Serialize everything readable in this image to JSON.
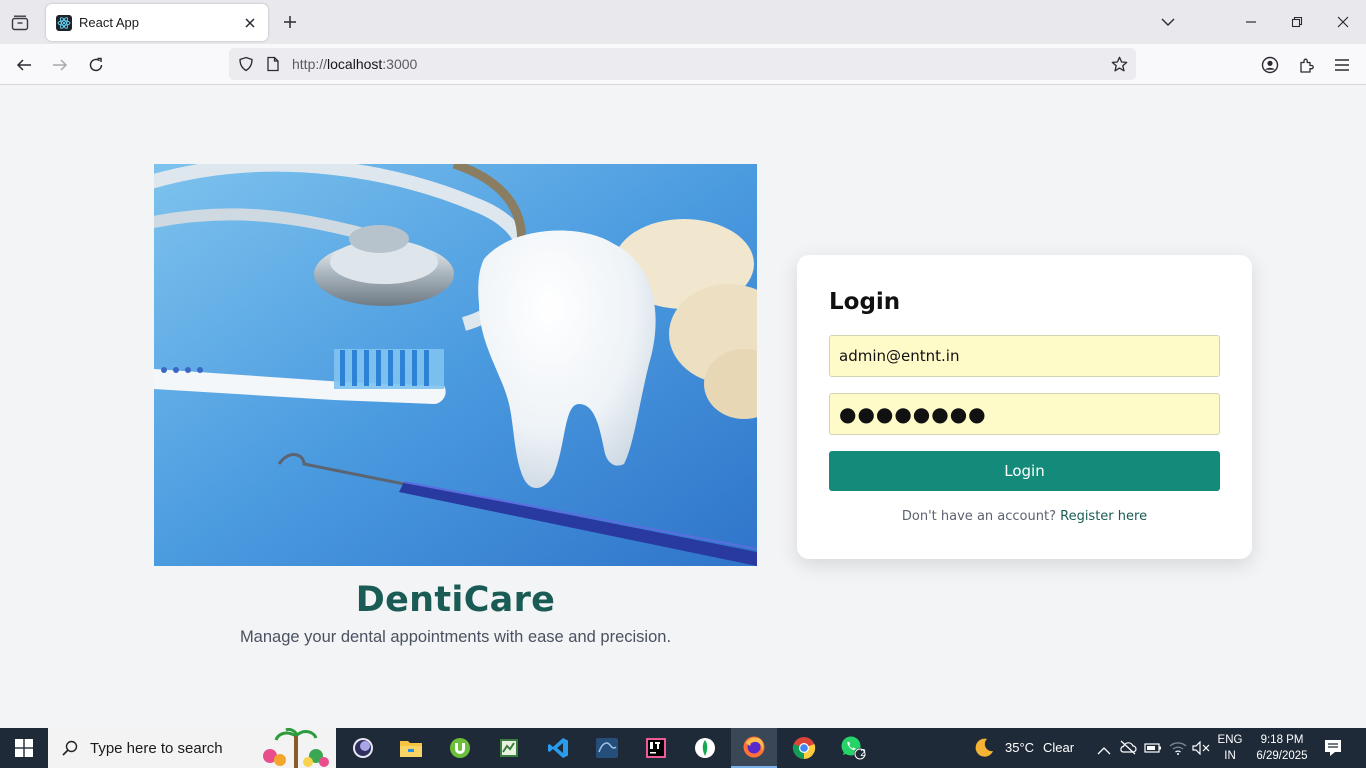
{
  "browser": {
    "tab_title": "React App",
    "url_prefix": "http://",
    "url_host": "localhost",
    "url_suffix": ":3000"
  },
  "page": {
    "brand_name": "DentiCare",
    "tagline": "Manage your dental appointments with ease and precision."
  },
  "login": {
    "heading": "Login",
    "email_value": "admin@entnt.in",
    "password_value": "●●●●●●●●",
    "submit_label": "Login",
    "register_prompt": "Don't have an account?",
    "register_link": "Register here"
  },
  "taskbar": {
    "search_placeholder": "Type here to search",
    "weather_temp": "35°C",
    "weather_cond": "Clear",
    "lang_1": "ENG",
    "lang_2": "IN",
    "time": "9:18 PM",
    "date": "6/29/2025",
    "whatsapp_badge": "2",
    "apps": [
      "obs-icon",
      "file-explorer-icon",
      "utorrent-icon",
      "sublime-icon",
      "vscode-icon",
      "mysql-workbench-icon",
      "intellij-icon",
      "mongodb-compass-icon",
      "firefox-icon",
      "chrome-icon",
      "whatsapp-icon"
    ]
  },
  "colors": {
    "brand": "#1a5c55",
    "button": "#138a7a",
    "autofill": "#fefbc8",
    "page_bg": "#f3f4f6"
  }
}
